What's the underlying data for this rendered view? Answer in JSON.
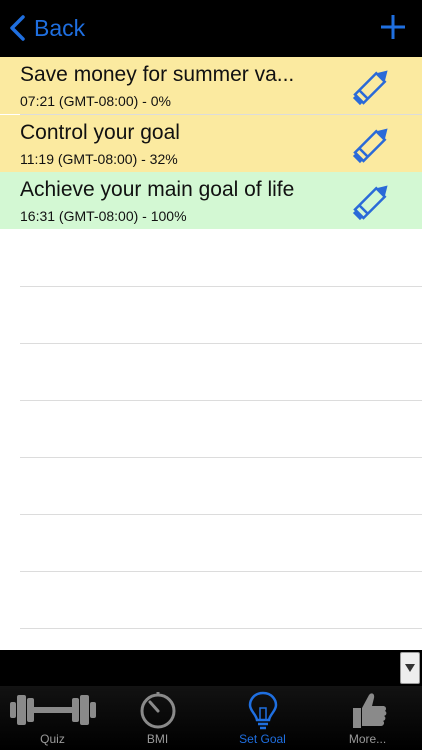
{
  "navbar": {
    "back_label": "Back"
  },
  "goals": [
    {
      "title": "Save money for summer va...",
      "subtitle": "07:21 (GMT-08:00) - 0%",
      "color": "#fbeaa0"
    },
    {
      "title": "Control your goal",
      "subtitle": "11:19 (GMT-08:00) - 32%",
      "color": "#fbeaa0"
    },
    {
      "title": "Achieve your main goal of life",
      "subtitle": "16:31 (GMT-08:00) - 100%",
      "color": "#d3f8d3"
    }
  ],
  "tabs": [
    {
      "label": "Quiz",
      "icon": "dumbbell-icon",
      "active": false
    },
    {
      "label": "BMI",
      "icon": "stopwatch-icon",
      "active": false
    },
    {
      "label": "Set Goal",
      "icon": "lightbulb-icon",
      "active": true
    },
    {
      "label": "More...",
      "icon": "thumbs-up-icon",
      "active": false
    }
  ],
  "colors": {
    "accent": "#1f6fe0",
    "tab_inactive": "#9a9a9a",
    "row_in_progress": "#fbeaa0",
    "row_complete": "#d3f8d3"
  }
}
